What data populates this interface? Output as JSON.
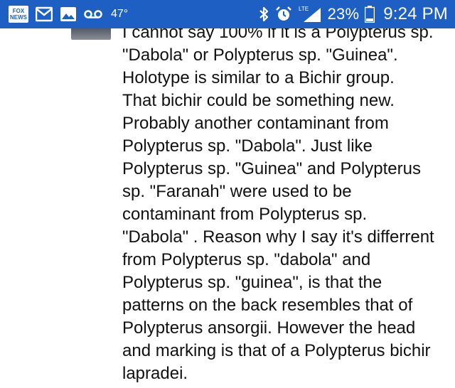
{
  "status_bar": {
    "left_icons": [
      "fox-news-icon",
      "gmail-icon",
      "gallery-icon",
      "voicemail-icon"
    ],
    "fox_lines": [
      "FOX",
      "NEWS"
    ],
    "temperature": "47°",
    "right_icons": [
      "bluetooth-icon",
      "alarm-icon",
      "lte-signal-icon",
      "battery-icon"
    ],
    "lte_label": "LTE",
    "battery": "23%",
    "time": "9:24 PM",
    "bar_color": "#1d5fc2"
  },
  "message": {
    "text": "I cannot say 100% if it is a Polypterus sp.\n\"Dabola\" or Polypterus sp. \"Guinea\".\nHolotype is similar to a Bichir group.\nThat bichir could be something new.\nProbably another contaminant from\nPolypterus sp. \"Dabola\". Just like\nPolypterus sp. \"Guinea\" and Polypterus\nsp. \"Faranah\" were used to be\ncontaminant from Polypterus sp.\n\"Dabola\" . Reason why I say it's differrent\nfrom Polypterus sp. \"dabola\" and\nPolypterus sp. \"guinea\", is that the\npatterns on the back resembles that of\nPolypterus ansorgii. However the head\nand marking is that of a Polypterus bichir\nlapradei."
  }
}
